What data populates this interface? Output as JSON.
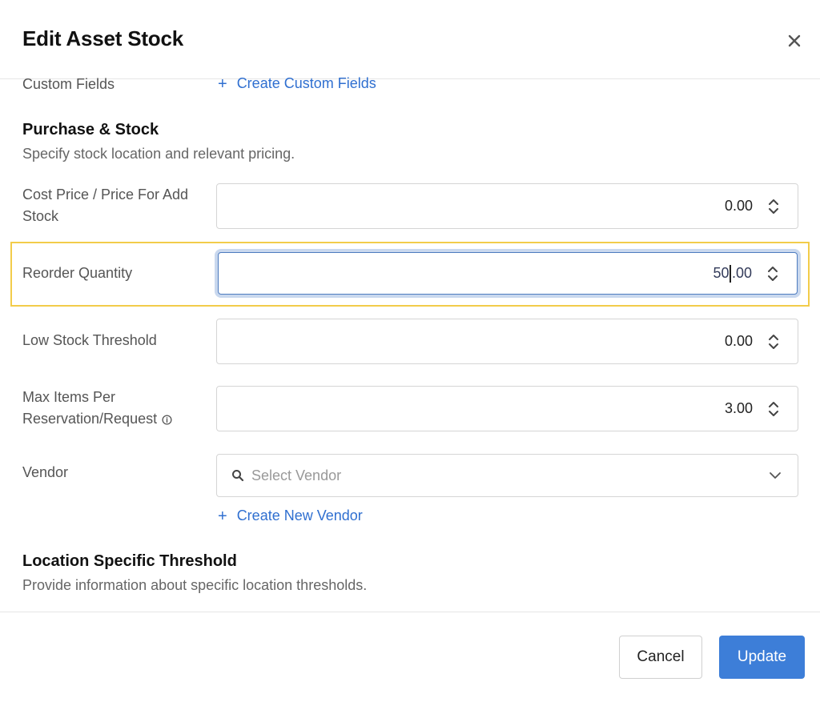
{
  "modal": {
    "title": "Edit Asset Stock"
  },
  "custom_fields": {
    "label": "Custom Fields",
    "link": "Create Custom Fields"
  },
  "purchase_stock": {
    "title": "Purchase & Stock",
    "description": "Specify stock location and relevant pricing.",
    "fields": {
      "cost_price": {
        "label": "Cost Price / Price For Add Stock",
        "value": "0.00"
      },
      "reorder_quantity": {
        "label": "Reorder Quantity",
        "value_before_caret": "50",
        "value_after_caret": ".00"
      },
      "low_stock_threshold": {
        "label": "Low Stock Threshold",
        "value": "0.00"
      },
      "max_items": {
        "label": "Max Items Per Reservation/Request",
        "value": "3.00"
      }
    },
    "vendor": {
      "label": "Vendor",
      "placeholder": "Select Vendor",
      "create_link": "Create New Vendor"
    }
  },
  "location_threshold": {
    "title": "Location Specific Threshold",
    "description": "Provide information about specific location thresholds."
  },
  "footer": {
    "cancel_label": "Cancel",
    "update_label": "Update"
  },
  "colors": {
    "primary": "#3d7ed8",
    "link": "#2f6fd0",
    "highlight": "#f2cc4a",
    "focus_border": "#4d7bbf"
  },
  "icons": {
    "close": "close-icon",
    "plus": "plus-icon",
    "spinner": "spinner-arrows-icon",
    "info": "info-icon",
    "search": "search-icon",
    "chevron": "chevron-down-icon"
  }
}
